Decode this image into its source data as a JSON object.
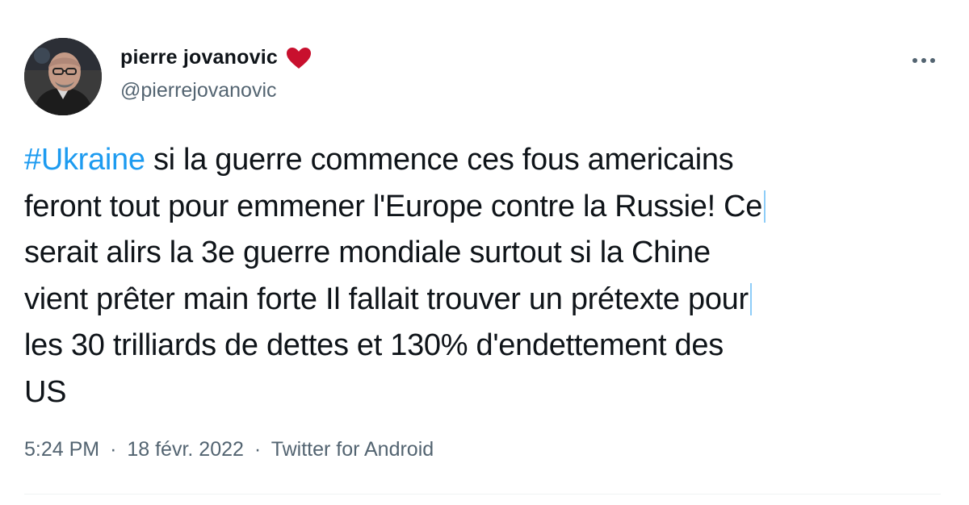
{
  "tweet": {
    "author": {
      "display_name": "pierre jovanovic",
      "handle": "@pierrejovanovic",
      "badge_icon": "heart-icon",
      "avatar_icon": "avatar"
    },
    "more_icon": "more-icon",
    "text": {
      "hashtag": "#Ukraine",
      "line1_rest": " si la guerre commence  ces fous americains",
      "line2": "feront tout pour emmener l'Europe contre la Russie! Ce",
      "line3": "serait alirs  la 3e guerre mondiale surtout si la Chine",
      "line4": "vient prêter main forte Il fallait trouver un prétexte pour",
      "line5": "les 30 trilliards de dettes et 130% d'endettement des",
      "line6": "US"
    },
    "meta": {
      "time": "5:24 PM",
      "separator": "·",
      "date": "18 févr. 2022",
      "source": "Twitter for Android"
    }
  },
  "colors": {
    "text": "#0f1419",
    "secondary": "#536471",
    "link": "#1d9bf0",
    "heart": "#c8102e",
    "divider": "#eff3f4"
  }
}
